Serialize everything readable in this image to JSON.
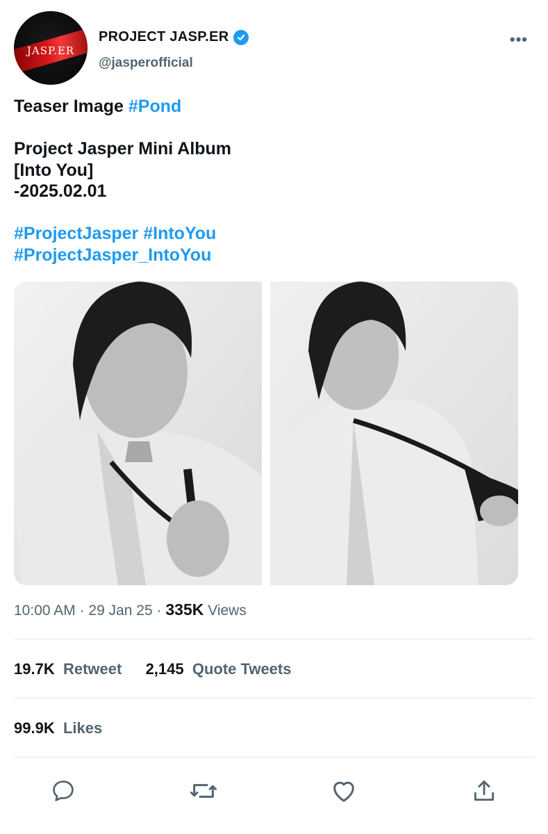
{
  "author": {
    "display_name": "PROJECT JASP.ER",
    "handle": "@jasperofficial",
    "avatar_text": "JASP.ER",
    "verified_color": "#1d9bf0"
  },
  "more_label": "•••",
  "tweet": {
    "line1_text": "Teaser Image ",
    "line1_tag": "#Pond",
    "line2": "Project Jasper Mini Album",
    "line3": "[Into You]",
    "line4": "-2025.02.01",
    "tag_line1_a": "#ProjectJasper",
    "tag_line1_b": "#IntoYou",
    "tag_line2": "#ProjectJasper_IntoYou"
  },
  "meta": {
    "time": "10:00 AM",
    "sep1": "·",
    "date": "29 Jan 25",
    "sep2": "·",
    "views_count": "335K",
    "views_label": "Views"
  },
  "stats": {
    "retweets_count": "19.7K",
    "retweets_label": "Retweet",
    "quotes_count": "2,145",
    "quotes_label": "Quote Tweets",
    "likes_count": "99.9K",
    "likes_label": "Likes"
  },
  "actions": [
    "reply-icon",
    "retweet-icon",
    "like-icon",
    "share-icon"
  ],
  "colors": {
    "link": "#1d9bf0",
    "secondary": "#536471",
    "divider": "#e1e6ea"
  }
}
